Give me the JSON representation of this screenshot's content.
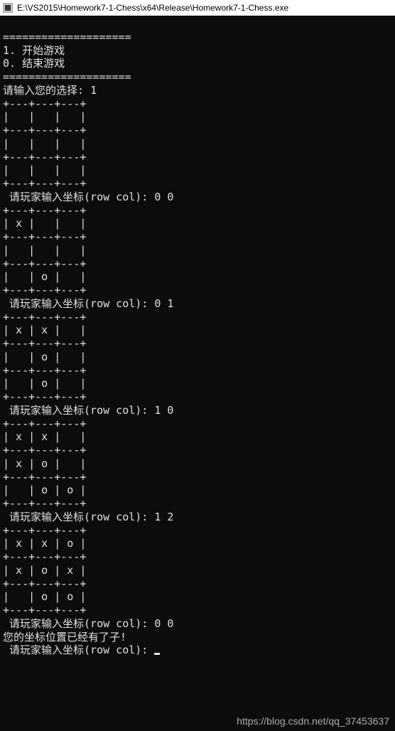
{
  "window": {
    "title": "E:\\VS2015\\Homework7-1-Chess\\x64\\Release\\Homework7-1-Chess.exe"
  },
  "menu": {
    "divider": "====================",
    "option1": "1. 开始游戏",
    "option0": "0. 结束游戏"
  },
  "prompts": {
    "choice_prompt": "请输入您的选择: ",
    "choice_value": "1",
    "coord_prompt": " 请玩家输入坐标(row col): ",
    "occupied_msg": "您的坐标位置已经有了子!"
  },
  "moves": {
    "m1": "0 0",
    "m2": "0 1",
    "m3": "1 0",
    "m4": "1 2",
    "m5": "0 0"
  },
  "boards": {
    "border": "+---+---+---+",
    "empty_row": "|   |   |   |",
    "b0_r0": "|   |   |   |",
    "b0_r1": "|   |   |   |",
    "b0_r2": "|   |   |   |",
    "b1_r0": "| x |   |   |",
    "b1_r1": "|   |   |   |",
    "b1_r2": "|   | o |   |",
    "b2_r0": "| x | x |   |",
    "b2_r1": "|   | o |   |",
    "b2_r2": "|   | o |   |",
    "b3_r0": "| x | x |   |",
    "b3_r1": "| x | o |   |",
    "b3_r2": "|   | o | o |",
    "b4_r0": "| x | x | o |",
    "b4_r1": "| x | o | x |",
    "b4_r2": "|   | o | o |"
  },
  "watermark": "https://blog.csdn.net/qq_37453637"
}
